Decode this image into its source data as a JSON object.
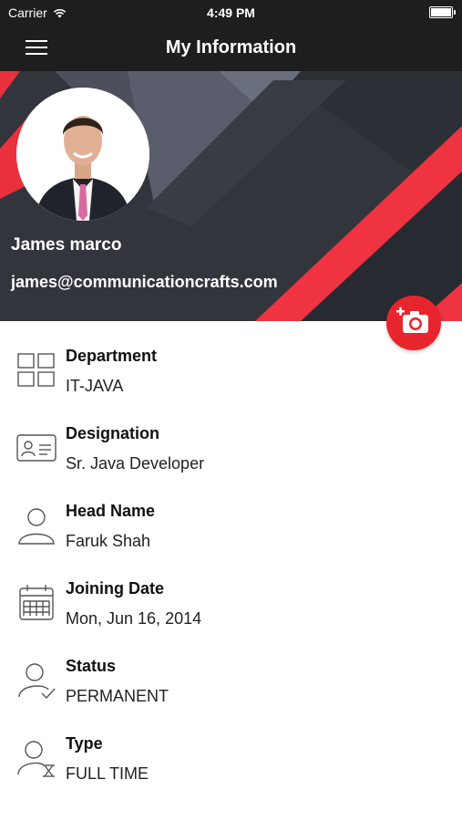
{
  "status_bar": {
    "carrier": "Carrier",
    "time": "4:49 PM"
  },
  "nav": {
    "title": "My Information"
  },
  "profile": {
    "name": "James marco",
    "email": "james@communicationcrafts.com"
  },
  "colors": {
    "accent": "#e8242c",
    "header_bg": "#1e1e1e",
    "hero_bg": "#2d2f36"
  },
  "info_items": [
    {
      "label": "Department",
      "value": "IT-JAVA",
      "icon": "department-grid-icon"
    },
    {
      "label": "Designation",
      "value": "Sr. Java Developer",
      "icon": "id-card-icon"
    },
    {
      "label": "Head Name",
      "value": "Faruk Shah",
      "icon": "person-icon"
    },
    {
      "label": "Joining Date",
      "value": "Mon, Jun 16, 2014",
      "icon": "calendar-icon"
    },
    {
      "label": "Status",
      "value": "PERMANENT",
      "icon": "person-check-icon"
    },
    {
      "label": "Type",
      "value": "FULL TIME",
      "icon": "person-hourglass-icon"
    }
  ]
}
